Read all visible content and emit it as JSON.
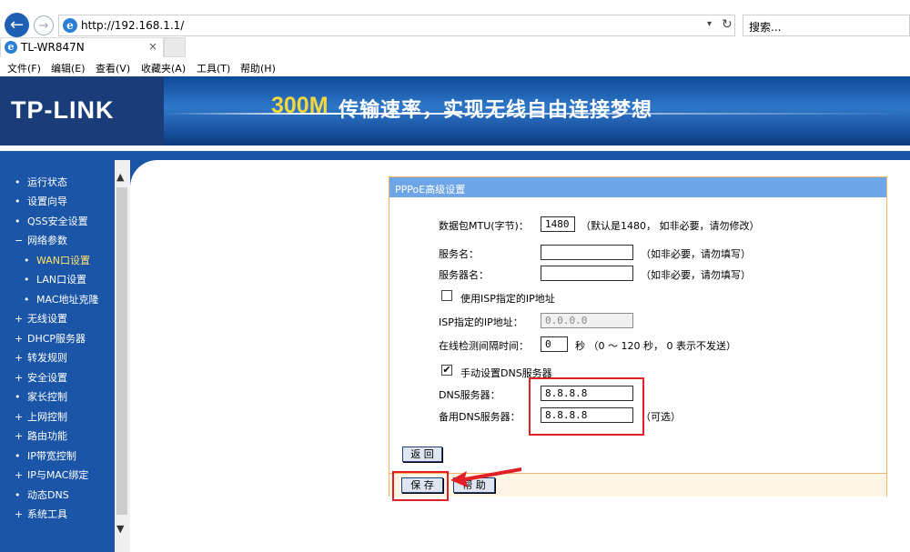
{
  "browser": {
    "url": "http://192.168.1.1/",
    "search_placeholder": "搜索...",
    "tab_title": "TL-WR847N",
    "tab_close": "×"
  },
  "menu": [
    "文件(F)",
    "编辑(E)",
    "查看(V)",
    "收藏夹(A)",
    "工具(T)",
    "帮助(H)"
  ],
  "banner": {
    "logo": "TP-LINK",
    "slogan_speed": "300M",
    "slogan_text": "传输速率，实现无线自由连接梦想"
  },
  "sidebar": {
    "items": [
      {
        "bullet": "•",
        "label": "运行状态"
      },
      {
        "bullet": "•",
        "label": "设置向导"
      },
      {
        "bullet": "•",
        "label": "QSS安全设置"
      },
      {
        "bullet": "−",
        "label": "网络参数"
      },
      {
        "bullet": "•",
        "label": "WAN口设置"
      },
      {
        "bullet": "•",
        "label": "LAN口设置"
      },
      {
        "bullet": "•",
        "label": "MAC地址克隆"
      },
      {
        "bullet": "+",
        "label": "无线设置"
      },
      {
        "bullet": "+",
        "label": "DHCP服务器"
      },
      {
        "bullet": "+",
        "label": "转发规则"
      },
      {
        "bullet": "+",
        "label": "安全设置"
      },
      {
        "bullet": "•",
        "label": "家长控制"
      },
      {
        "bullet": "+",
        "label": "上网控制"
      },
      {
        "bullet": "+",
        "label": "路由功能"
      },
      {
        "bullet": "•",
        "label": "IP带宽控制"
      },
      {
        "bullet": "+",
        "label": "IP与MAC绑定"
      },
      {
        "bullet": "•",
        "label": "动态DNS"
      },
      {
        "bullet": "+",
        "label": "系统工具"
      }
    ]
  },
  "panel": {
    "title": "PPPoE高级设置",
    "mtu_label": "数据包MTU(字节)：",
    "mtu_value": "1480",
    "mtu_hint": "（默认是1480， 如非必要，请勿修改）",
    "service_label": "服务名：",
    "service_hint": "（如非必要，请勿填写）",
    "server_label": "服务器名：",
    "server_hint": "（如非必要，请勿填写）",
    "isp_ip_checkbox": "使用ISP指定的IP地址",
    "isp_ip_checked": false,
    "isp_ip_label": "ISP指定的IP地址：",
    "isp_ip_value": "0.0.0.0",
    "interval_label": "在线检测间隔时间：",
    "interval_value": "0",
    "interval_hint": "秒 （0 ～ 120 秒， 0 表示不发送）",
    "dns_checkbox": "手动设置DNS服务器",
    "dns_checked": true,
    "dns_label": "DNS服务器：",
    "dns_value": "8.8.8.8",
    "dns2_label": "备用DNS服务器：",
    "dns2_value": "8.8.8.8",
    "dns2_hint": "（可选）",
    "back_button": "返 回",
    "save_button": "保 存",
    "help_button": "帮 助",
    "check_mark": "✔"
  },
  "colors": {
    "annotation_red": "#e21f26",
    "sidebar_blue": "#1a55a8",
    "panel_header": "#6ea5e8",
    "panel_border": "#f2b46b"
  }
}
